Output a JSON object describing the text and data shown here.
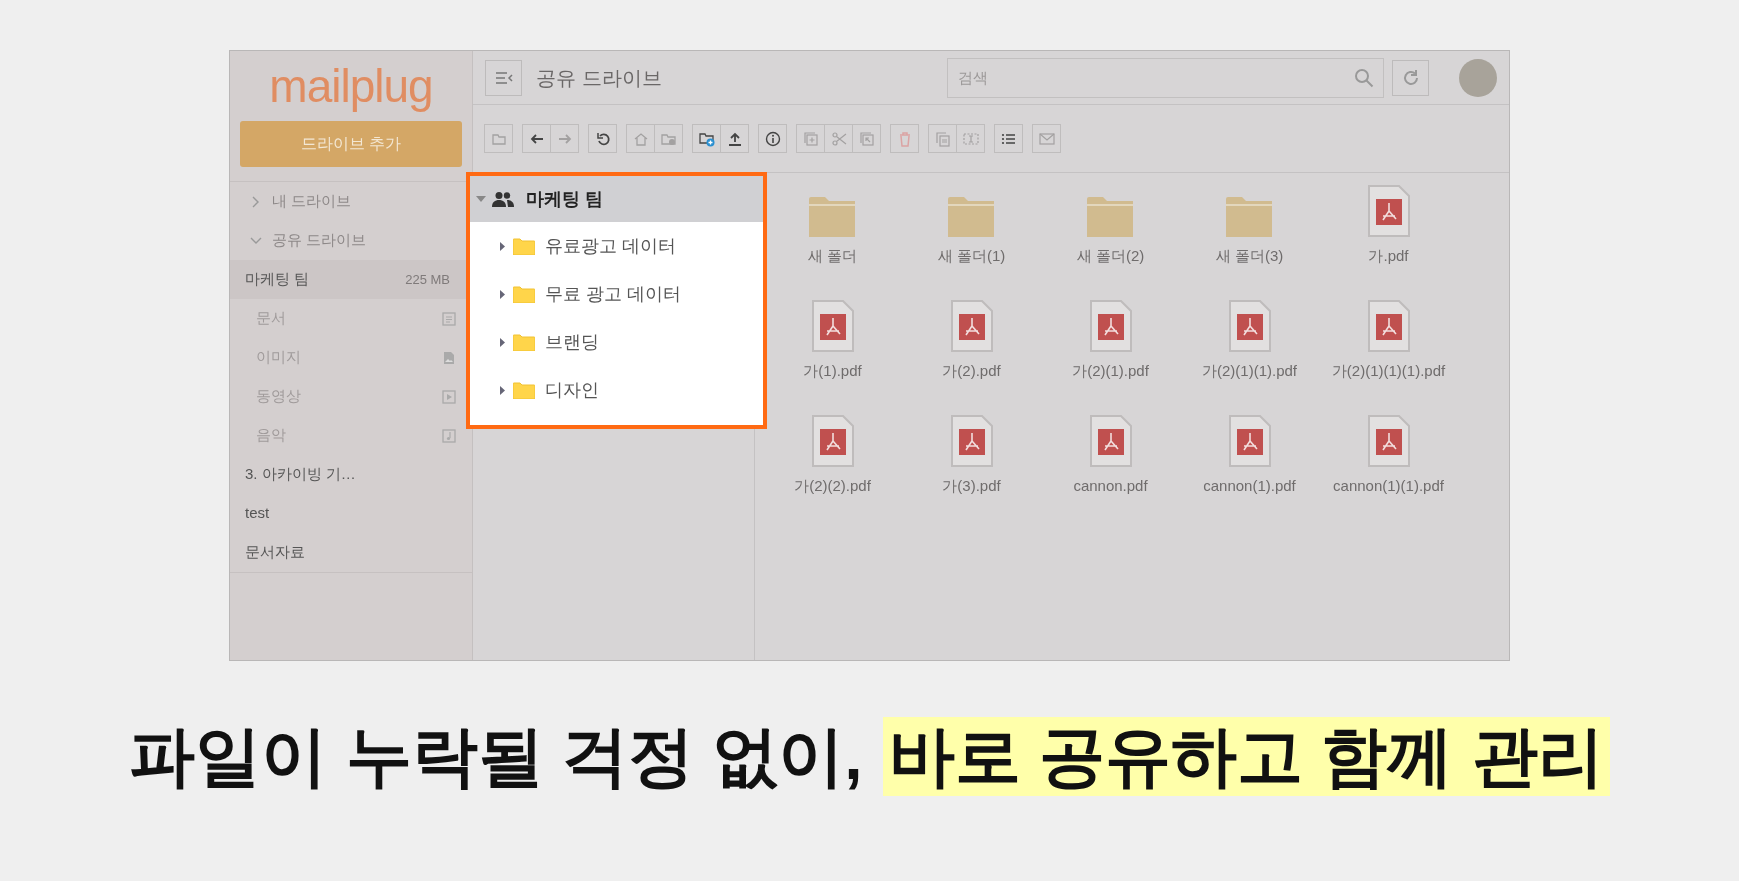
{
  "sidebar": {
    "logo": "mailplug",
    "add_button": "드라이브 추가",
    "sections": [
      {
        "label": "내 드라이브",
        "expanded": false
      },
      {
        "label": "공유 드라이브",
        "expanded": true,
        "children": [
          {
            "label": "마케팅 팀",
            "size": "225 MB",
            "selected": true,
            "children": [
              {
                "label": "문서",
                "kind": "document"
              },
              {
                "label": "이미지",
                "kind": "image"
              },
              {
                "label": "동영상",
                "kind": "video"
              },
              {
                "label": "음악",
                "kind": "music"
              }
            ]
          },
          {
            "label": "3. 아카이빙 기…",
            "selected": false
          },
          {
            "label": "test",
            "selected": false
          },
          {
            "label": "문서자료",
            "selected": false
          }
        ]
      }
    ]
  },
  "header": {
    "title": "공유 드라이브",
    "search": {
      "placeholder": "검색"
    }
  },
  "toolbar": [
    [
      {
        "kind": "folder",
        "disabled": true
      }
    ],
    [
      {
        "kind": "back",
        "disabled": false
      },
      {
        "kind": "forward",
        "disabled": true
      }
    ],
    [
      {
        "kind": "undo",
        "disabled": false
      }
    ],
    [
      {
        "kind": "home",
        "disabled": true
      },
      {
        "kind": "folder-gear",
        "disabled": true
      }
    ],
    [
      {
        "kind": "folder-plus",
        "disabled": false
      },
      {
        "kind": "upload",
        "disabled": false
      }
    ],
    [
      {
        "kind": "info",
        "disabled": false
      }
    ],
    [
      {
        "kind": "copy-plus",
        "disabled": true
      },
      {
        "kind": "scissors",
        "disabled": true
      },
      {
        "kind": "move",
        "disabled": true
      }
    ],
    [
      {
        "kind": "trash",
        "disabled": true
      }
    ],
    [
      {
        "kind": "copy",
        "disabled": true
      },
      {
        "kind": "rename",
        "disabled": true
      }
    ],
    [
      {
        "kind": "list",
        "disabled": false
      }
    ],
    [
      {
        "kind": "mail",
        "disabled": true
      }
    ]
  ],
  "tree": {
    "label": "마케팅 팀",
    "expanded": true,
    "selected": true,
    "children": [
      {
        "label": "유료광고 데이터",
        "expanded": false
      },
      {
        "label": "무료 광고 데이터",
        "expanded": false
      },
      {
        "label": "브랜딩",
        "expanded": false
      },
      {
        "label": "디자인",
        "expanded": false
      }
    ]
  },
  "files": [
    {
      "kind": "folder",
      "name": "새 폴더"
    },
    {
      "kind": "folder",
      "name": "새 폴더(1)"
    },
    {
      "kind": "folder",
      "name": "새 폴더(2)"
    },
    {
      "kind": "folder",
      "name": "새 폴더(3)"
    },
    {
      "kind": "pdf",
      "name": "가.pdf"
    },
    {
      "kind": "pdf",
      "name": "가(1).pdf"
    },
    {
      "kind": "pdf",
      "name": "가(2).pdf"
    },
    {
      "kind": "pdf",
      "name": "가(2)(1).pdf"
    },
    {
      "kind": "pdf",
      "name": "가(2)(1)(1).pdf"
    },
    {
      "kind": "pdf",
      "name": "가(2)(1)(1)(1).pdf"
    },
    {
      "kind": "pdf",
      "name": "가(2)(2).pdf"
    },
    {
      "kind": "pdf",
      "name": "가(3).pdf"
    },
    {
      "kind": "pdf",
      "name": "cannon.pdf"
    },
    {
      "kind": "pdf",
      "name": "cannon(1).pdf"
    },
    {
      "kind": "pdf",
      "name": "cannon(1)(1).pdf"
    }
  ],
  "caption": [
    {
      "text": "파일이 누락될 걱정 없이,",
      "highlighted": false
    },
    {
      "text": "바로 공유하고 함께 관리",
      "highlighted": true
    }
  ]
}
